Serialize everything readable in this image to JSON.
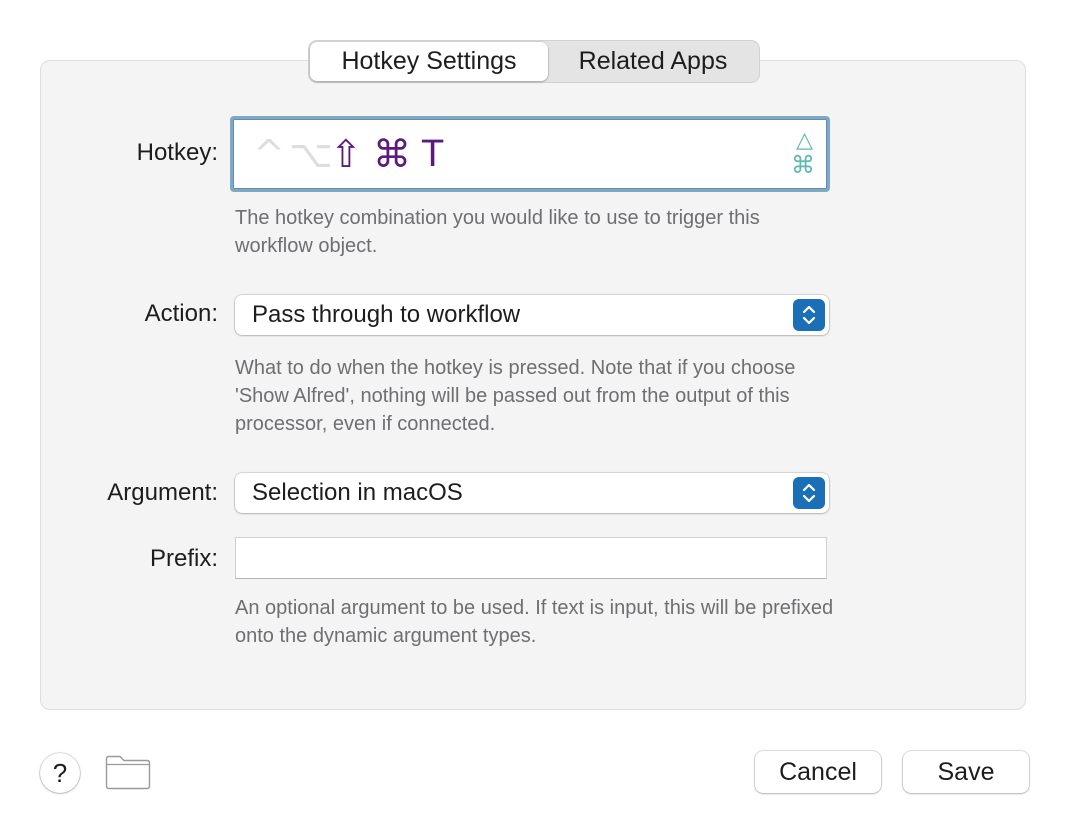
{
  "tabs": [
    {
      "label": "Hotkey Settings",
      "active": true
    },
    {
      "label": "Related Apps",
      "active": false
    }
  ],
  "hotkey": {
    "label": "Hotkey:",
    "keys": {
      "control": "^",
      "option": "⌥",
      "shift": "⇧",
      "command": "⌘",
      "key": "T"
    },
    "side_icons": {
      "triangle": "△",
      "command": "⌘"
    },
    "active_modifier_color": "#5c1a7e",
    "inactive_modifier_color": "#dedede",
    "help": "The hotkey combination you would like to use to trigger this workflow object."
  },
  "action": {
    "label": "Action:",
    "selected": "Pass through to workflow",
    "help": "What to do when the hotkey is pressed. Note that if you choose 'Show Alfred', nothing will be passed out from the output of this processor, even if connected."
  },
  "argument": {
    "label": "Argument:",
    "selected": "Selection in macOS"
  },
  "prefix": {
    "label": "Prefix:",
    "value": "",
    "help": "An optional argument to be used. If text is input, this will be prefixed onto the dynamic argument types."
  },
  "footer": {
    "help_label": "?",
    "cancel_label": "Cancel",
    "save_label": "Save"
  },
  "colors": {
    "accent": "#1a6fb7",
    "focus_ring": "#7fa8c4",
    "side_icon": "#5cb8b0"
  }
}
